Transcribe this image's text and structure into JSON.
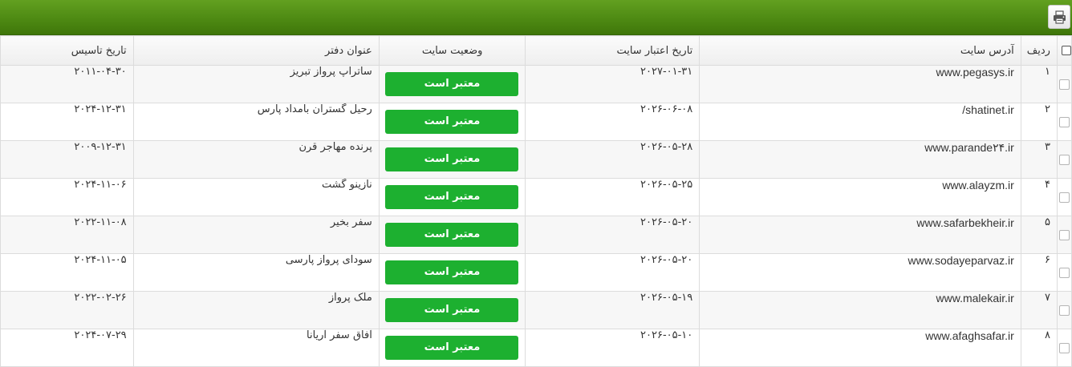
{
  "toolbar": {
    "print_icon": "printer-icon"
  },
  "table": {
    "headers": {
      "row": "ردیف",
      "address": "آدرس سایت",
      "valid_until": "تاریخ اعتبار سایت",
      "status": "وضعیت سایت",
      "office": "عنوان دفتر",
      "established": "تاریخ تاسیس"
    },
    "rows": [
      {
        "num": "۱",
        "address": "www.pegasys.ir",
        "valid_until": "۲۰۲۷-۰۱-۳۱",
        "status": "معتبر است",
        "office": "ساتراپ پرواز تبریز",
        "established": "۲۰۱۱-۰۴-۳۰"
      },
      {
        "num": "۲",
        "address": "/shatinet.ir",
        "valid_until": "۲۰۲۶-۰۶-۰۸",
        "status": "معتبر است",
        "office": "رحیل گستران بامداد پارس",
        "established": "۲۰۲۴-۱۲-۳۱"
      },
      {
        "num": "۳",
        "address": "www.parande۲۴.ir",
        "valid_until": "۲۰۲۶-۰۵-۲۸",
        "status": "معتبر است",
        "office": "پرنده مهاجر قرن",
        "established": "۲۰۰۹-۱۲-۳۱"
      },
      {
        "num": "۴",
        "address": "www.alayzm.ir",
        "valid_until": "۲۰۲۶-۰۵-۲۵",
        "status": "معتبر است",
        "office": "نازینو گشت",
        "established": "۲۰۲۴-۱۱-۰۶"
      },
      {
        "num": "۵",
        "address": "www.safarbekheir.ir",
        "valid_until": "۲۰۲۶-۰۵-۲۰",
        "status": "معتبر است",
        "office": "سفر بخیر",
        "established": "۲۰۲۲-۱۱-۰۸"
      },
      {
        "num": "۶",
        "address": "www.sodayeparvaz.ir",
        "valid_until": "۲۰۲۶-۰۵-۲۰",
        "status": "معتبر است",
        "office": "سودای پرواز پارسی",
        "established": "۲۰۲۴-۱۱-۰۵"
      },
      {
        "num": "۷",
        "address": "www.malekair.ir",
        "valid_until": "۲۰۲۶-۰۵-۱۹",
        "status": "معتبر است",
        "office": "ملک پرواز",
        "established": "۲۰۲۲-۰۲-۲۶"
      },
      {
        "num": "۸",
        "address": "www.afaghsafar.ir",
        "valid_until": "۲۰۲۶-۰۵-۱۰",
        "status": "معتبر است",
        "office": "آفاق سفر آریانا",
        "established": "۲۰۲۴-۰۷-۲۹"
      }
    ]
  },
  "colors": {
    "topbar": "#4e8a13",
    "status_badge": "#1db030"
  }
}
